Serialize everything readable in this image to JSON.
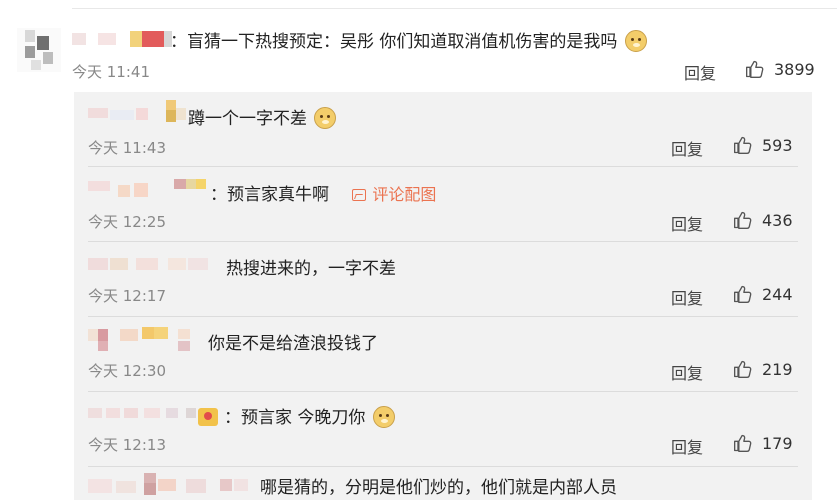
{
  "main_comment": {
    "text": "：盲猜一下热搜预定：吴彤 你们知道取消值机伤害的是我吗",
    "time": "今天 11:41",
    "reply_label": "回复",
    "likes": "3899"
  },
  "replies": [
    {
      "text": "蹲一个一字不差",
      "time": "今天 11:43",
      "reply_label": "回复",
      "likes": "593",
      "doge": true
    },
    {
      "text": "：预言家真牛啊",
      "image_link": "评论配图",
      "time": "今天 12:25",
      "reply_label": "回复",
      "likes": "436"
    },
    {
      "text": "热搜进来的，一字不差",
      "time": "今天 12:17",
      "reply_label": "回复",
      "likes": "244"
    },
    {
      "text": "你是不是给渣浪投钱了",
      "time": "今天 12:30",
      "reply_label": "回复",
      "likes": "219"
    },
    {
      "text": "：预言家 今晚刀你",
      "time": "今天 12:13",
      "reply_label": "回复",
      "likes": "179",
      "doge": true,
      "badge": true
    },
    {
      "text": "哪是猜的，分明是他们炒的，他们就是内部人员"
    }
  ],
  "colors": {
    "accent_link": "#eb7350",
    "reply_bg": "#f2f2f2",
    "meta_gray": "#888888"
  },
  "icons": {
    "like": "thumbs-up-icon",
    "image_link": "image-icon",
    "emoji": "doge-emoji-icon"
  }
}
